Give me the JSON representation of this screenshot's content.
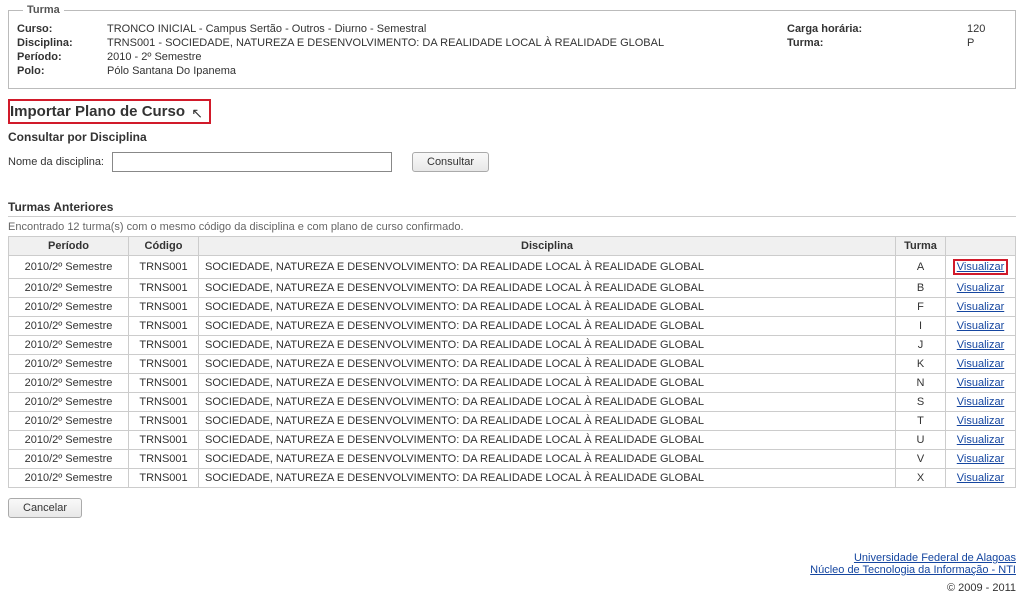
{
  "turma": {
    "legend": "Turma",
    "curso_label": "Curso:",
    "curso": "TRONCO INICIAL - Campus Sertão - Outros - Diurno - Semestral",
    "disciplina_label": "Disciplina:",
    "disciplina": "TRNS001 - SOCIEDADE, NATUREZA E DESENVOLVIMENTO: DA REALIDADE LOCAL À REALIDADE GLOBAL",
    "periodo_label": "Período:",
    "periodo": "2010 - 2º Semestre",
    "polo_label": "Polo:",
    "polo": "Pólo Santana Do Ipanema",
    "carga_label": "Carga horária:",
    "carga": "120",
    "turma_label": "Turma:",
    "turma_val": "P"
  },
  "page_title": "Importar Plano de Curso",
  "consult_section": "Consultar por Disciplina",
  "search": {
    "label": "Nome da disciplina:",
    "value": "",
    "button": "Consultar"
  },
  "previous": {
    "title": "Turmas Anteriores",
    "found": "Encontrado 12 turma(s) com o mesmo código da disciplina e com plano de curso confirmado.",
    "headers": {
      "periodo": "Período",
      "codigo": "Código",
      "disciplina": "Disciplina",
      "turma": "Turma",
      "action": ""
    },
    "link_label": "Visualizar",
    "rows": [
      {
        "periodo": "2010/2º Semestre",
        "codigo": "TRNS001",
        "disciplina": "SOCIEDADE, NATUREZA E DESENVOLVIMENTO: DA REALIDADE LOCAL À REALIDADE GLOBAL",
        "turma": "A",
        "highlighted": true
      },
      {
        "periodo": "2010/2º Semestre",
        "codigo": "TRNS001",
        "disciplina": "SOCIEDADE, NATUREZA E DESENVOLVIMENTO: DA REALIDADE LOCAL À REALIDADE GLOBAL",
        "turma": "B",
        "highlighted": false
      },
      {
        "periodo": "2010/2º Semestre",
        "codigo": "TRNS001",
        "disciplina": "SOCIEDADE, NATUREZA E DESENVOLVIMENTO: DA REALIDADE LOCAL À REALIDADE GLOBAL",
        "turma": "F",
        "highlighted": false
      },
      {
        "periodo": "2010/2º Semestre",
        "codigo": "TRNS001",
        "disciplina": "SOCIEDADE, NATUREZA E DESENVOLVIMENTO: DA REALIDADE LOCAL À REALIDADE GLOBAL",
        "turma": "I",
        "highlighted": false
      },
      {
        "periodo": "2010/2º Semestre",
        "codigo": "TRNS001",
        "disciplina": "SOCIEDADE, NATUREZA E DESENVOLVIMENTO: DA REALIDADE LOCAL À REALIDADE GLOBAL",
        "turma": "J",
        "highlighted": false
      },
      {
        "periodo": "2010/2º Semestre",
        "codigo": "TRNS001",
        "disciplina": "SOCIEDADE, NATUREZA E DESENVOLVIMENTO: DA REALIDADE LOCAL À REALIDADE GLOBAL",
        "turma": "K",
        "highlighted": false
      },
      {
        "periodo": "2010/2º Semestre",
        "codigo": "TRNS001",
        "disciplina": "SOCIEDADE, NATUREZA E DESENVOLVIMENTO: DA REALIDADE LOCAL À REALIDADE GLOBAL",
        "turma": "N",
        "highlighted": false
      },
      {
        "periodo": "2010/2º Semestre",
        "codigo": "TRNS001",
        "disciplina": "SOCIEDADE, NATUREZA E DESENVOLVIMENTO: DA REALIDADE LOCAL À REALIDADE GLOBAL",
        "turma": "S",
        "highlighted": false
      },
      {
        "periodo": "2010/2º Semestre",
        "codigo": "TRNS001",
        "disciplina": "SOCIEDADE, NATUREZA E DESENVOLVIMENTO: DA REALIDADE LOCAL À REALIDADE GLOBAL",
        "turma": "T",
        "highlighted": false
      },
      {
        "periodo": "2010/2º Semestre",
        "codigo": "TRNS001",
        "disciplina": "SOCIEDADE, NATUREZA E DESENVOLVIMENTO: DA REALIDADE LOCAL À REALIDADE GLOBAL",
        "turma": "U",
        "highlighted": false
      },
      {
        "periodo": "2010/2º Semestre",
        "codigo": "TRNS001",
        "disciplina": "SOCIEDADE, NATUREZA E DESENVOLVIMENTO: DA REALIDADE LOCAL À REALIDADE GLOBAL",
        "turma": "V",
        "highlighted": false
      },
      {
        "periodo": "2010/2º Semestre",
        "codigo": "TRNS001",
        "disciplina": "SOCIEDADE, NATUREZA E DESENVOLVIMENTO: DA REALIDADE LOCAL À REALIDADE GLOBAL",
        "turma": "X",
        "highlighted": false
      }
    ]
  },
  "cancel_label": "Cancelar",
  "footer": {
    "link1": "Universidade Federal de Alagoas",
    "link2": "Núcleo de Tecnologia da Informação - NTI",
    "copyright": "© 2009 - 2011"
  }
}
